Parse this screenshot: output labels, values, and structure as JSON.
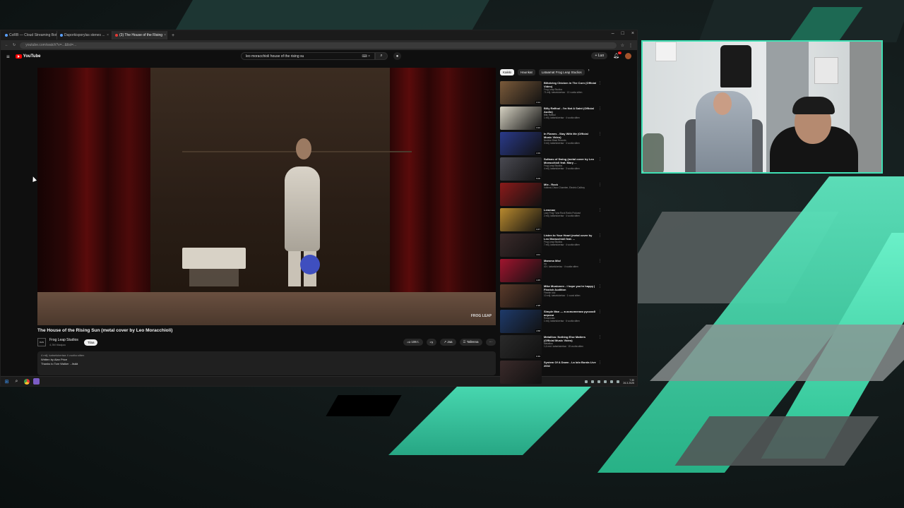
{
  "browser": {
    "tabs": [
      {
        "label": "CoRB — Cloud Streaming Bot",
        "active": false
      },
      {
        "label": "Daporkisporylas stenes ...",
        "active": false
      },
      {
        "label": "(3) The House of the Rising",
        "active": true
      }
    ],
    "url": "youtube.com/watch?v=...&list=..."
  },
  "youtube": {
    "logo_text": "YouTube",
    "search_query": "leo moracchioli house of the rising su",
    "create_label": "+ Luo",
    "notifications_count": "9+"
  },
  "video": {
    "title": "The House of the Rising Sun (metal cover by Leo Moracchioli)",
    "watermark": "FROG LEAP",
    "channel": "Frog Leap Studios",
    "subscribers": "4,3M tilaajaa",
    "subscribe_label": "Tilaa",
    "likes": "106 t.",
    "share_label": "Jaa",
    "save_label": "Tallenna",
    "description_meta": "4 milj. katselukertaa  4 vuotta sitten",
    "description_line1": "Written by Alan Price",
    "description_line2": "Thanks to Tom Walker ...lisää"
  },
  "sidebar": {
    "chips": [
      "Kaikki",
      "Haunkat",
      "Lataamat Frog Leap Studios"
    ],
    "recommendations": [
      {
        "title": "Blitzkrieg Chicken in The Corn (Official Video)",
        "channel": "Frog Leap Studios",
        "meta": "71 milj. katselukertaa · 13 vuotta sitten",
        "duration": "3:14",
        "thumb": "#7a5a3a"
      },
      {
        "title": "Billy Raffoul - I'm Not A Saint (Official Audio)",
        "channel": "Billy Raffoul",
        "meta": "1 milj. katselukertaa · 4 vuotta sitten",
        "duration": "3:22",
        "thumb": "#d6d2c2"
      },
      {
        "title": "In Flames - Stay With Me (Official Music Video)",
        "channel": "Nuclear Blast Records",
        "meta": "3 milj. katselukertaa · 4 vuotta sitten",
        "duration": "4:19",
        "thumb": "#2a3a8a"
      },
      {
        "title": "Sultans of Swing (metal cover by Leo Moracchioli feat. Mary ...",
        "channel": "Frog Leap Studios",
        "meta": "4 milj. katselukertaa · 3 vuotta sitten",
        "duration": "5:09",
        "thumb": "#4a4a52"
      },
      {
        "title": "Mix - Rock",
        "channel": "Volbeat, Disco Chamber, Electric Callboy",
        "meta": "",
        "duration": "",
        "thumb": "#8a1a1a"
      },
      {
        "title": "Lemmav",
        "channel": "Lazy Frog Tuna Rock Radio Podcast",
        "meta": "2 milj. katselukertaa · 4 vuotta sitten",
        "duration": "3:47",
        "thumb": "#b8892e"
      },
      {
        "title": "Listen to Your Heart (metal cover by Leo Moracchioli feat. ...",
        "channel": "Frog Leap Studios",
        "meta": "7 milj. katselukertaa · 4 vuotta sitten",
        "duration": "4:01",
        "thumb": "#3a2a2a"
      },
      {
        "title": "Mamma Mia!",
        "channel": "Ira",
        "meta": "40 t. katselukertaa · 4 vuotta sitten",
        "duration": "4:45",
        "thumb": "#a0142e"
      },
      {
        "title": "Mike Mustonen - I hope you're happy | Finnish Audition",
        "channel": "Finnish Idol",
        "meta": "10 milj. katselukertaa · 1 vuosi sitten",
        "duration": "2:38",
        "thumb": "#5a3a2a"
      },
      {
        "title": "Simple Man — в исполнении русской версии",
        "channel": "Rossmusic",
        "meta": "1 milj. katselukertaa · 6 vuotta sitten",
        "duration": "4:58",
        "thumb": "#1e3a6a"
      },
      {
        "title": "Metallica: Nothing Else Matters (Official Music Video)",
        "channel": "Metallica",
        "meta": "1,6 mrd. katselukertaa · 15 vuotta sitten",
        "duration": "6:39",
        "thumb": "#2a2a2a"
      },
      {
        "title": "System Of A Down - La lolo Borda Live 2002",
        "channel": "",
        "meta": "",
        "duration": "",
        "thumb": "#3a2a2a"
      }
    ]
  },
  "taskbar": {
    "time": "7.30",
    "date": "26.3.2025"
  }
}
